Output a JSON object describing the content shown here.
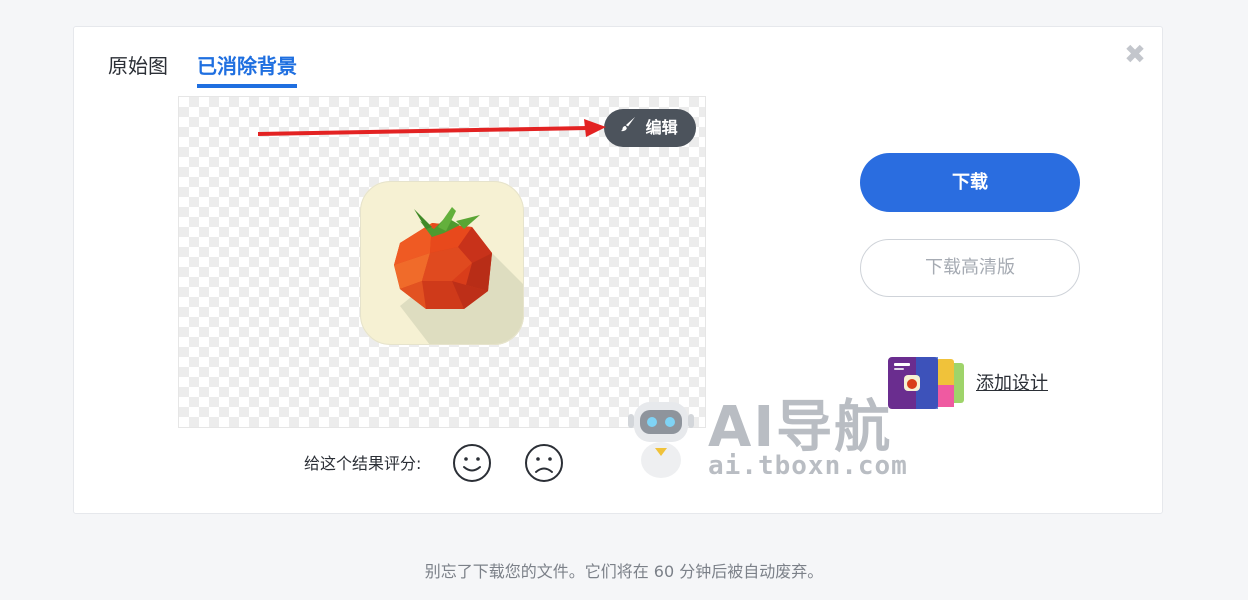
{
  "tabs": [
    {
      "label": "原始图",
      "active": false
    },
    {
      "label": "已消除背景",
      "active": true
    }
  ],
  "preview": {
    "edit_label": "编辑"
  },
  "rating": {
    "label": "给这个结果评分:"
  },
  "actions": {
    "download_label": "下载",
    "download_hd_label": "下载高清版",
    "add_design_label": "添加设计"
  },
  "watermark": {
    "title": "AI导航",
    "url": "ai.tboxn.com"
  },
  "footer_note": "别忘了下载您的文件。它们将在 60 分钟后被自动废弃。",
  "icons": {
    "close": "close-icon",
    "edit": "brush-icon",
    "happy": "smiley-happy-icon",
    "sad": "smiley-sad-icon"
  },
  "colors": {
    "accent": "#2a6de0",
    "tab_active": "#1f6fe0",
    "annotation_arrow": "#e32222",
    "edit_button_bg": "#4c535c"
  }
}
